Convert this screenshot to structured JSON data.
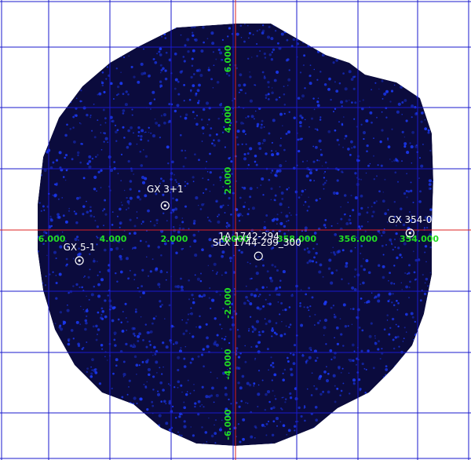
{
  "map": {
    "colors": {
      "background": "#ffffff",
      "field": "#0b0b3d",
      "noise_dot": "#1c3cff",
      "grid": "#1a1acc",
      "axis": "#dd2222",
      "tick_label": "#22dd22",
      "source": "#ffffff"
    },
    "longitude_ticks": [
      "6.000",
      "4.000",
      "2.000",
      "0.000",
      "358.000",
      "356.000",
      "354.000"
    ],
    "latitude_ticks": [
      "6.000",
      "4.000",
      "2.000",
      "-2.000",
      "-4.000",
      "-6.000"
    ],
    "sources": [
      {
        "name": "GX 3+1",
        "l": 2.3,
        "b": 0.8,
        "marker": "ring"
      },
      {
        "name": "GX 5-1",
        "l": 5.1,
        "b": -1.0,
        "marker": "ring"
      },
      {
        "name": "1A 1742-294",
        "l": -0.8,
        "b": -0.2,
        "marker": "none"
      },
      {
        "name": "SLX 1744-299_300",
        "l": -0.75,
        "b": -0.85,
        "marker": "circle"
      },
      {
        "name": "GX 354-0",
        "l": -5.7,
        "b": -0.1,
        "marker": "ring"
      }
    ]
  }
}
